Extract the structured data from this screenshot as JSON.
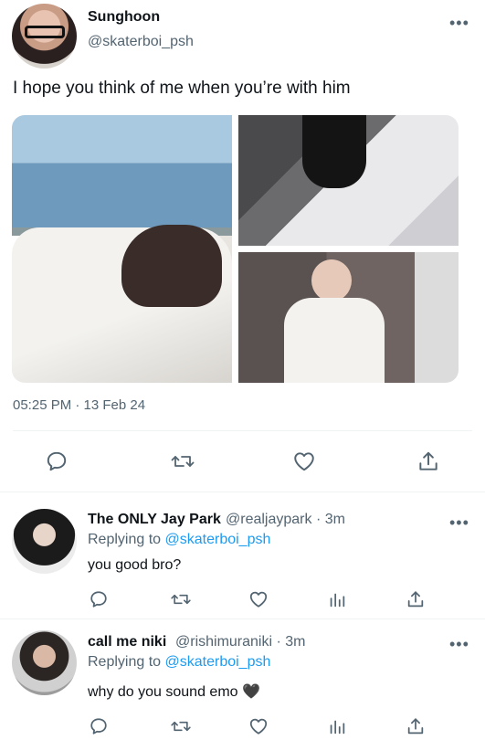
{
  "main_tweet": {
    "author_name": "Sunghoon",
    "author_handle": "@skaterboi_psh",
    "more_label": "•••",
    "text": "I hope you think of me when you’re with him",
    "timestamp": "05:25 PM · 13 Feb 24",
    "actions": [
      "reply-icon",
      "retweet-icon",
      "like-icon",
      "share-icon"
    ]
  },
  "replies": [
    {
      "author_name": "The ONLY Jay Park",
      "meta": "@realjaypark · 3m",
      "replying_prefix": "Replying to ",
      "replying_to": "@skaterboi_psh",
      "text": "you good bro?",
      "more_label": "•••"
    },
    {
      "author_name": "call me niki",
      "meta": "@rishimuraniki · 3m",
      "replying_prefix": "Replying to ",
      "replying_to": "@skaterboi_psh",
      "text": "why do you sound emo 🖤",
      "more_label": "•••"
    }
  ],
  "colors": {
    "text_primary": "#0f1419",
    "text_secondary": "#536471",
    "link": "#1d9bf0",
    "divider": "#eff3f4"
  }
}
